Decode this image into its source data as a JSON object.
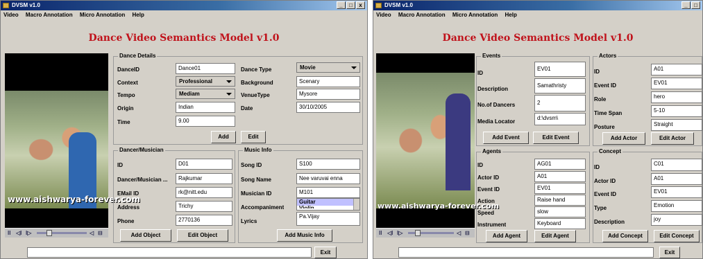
{
  "window_left": {
    "title": "DVSM v1.0",
    "menu": [
      "Video",
      "Macro Annotation",
      "Micro Annotation",
      "Help"
    ],
    "app_title": "Dance Video Semantics Model v1.0",
    "watermark": "www.aishwarya-forever.com",
    "dance_details": {
      "group_title": "Dance Details",
      "dance_id_label": "DanceID",
      "dance_id_value": "Dance01",
      "context_label": "Context",
      "context_value": "Professional",
      "tempo_label": "Tempo",
      "tempo_value": "Mediam",
      "origin_label": "Origin",
      "origin_value": "Indian",
      "time_label": "Time",
      "time_value": "9.00",
      "dance_type_label": "Dance Type",
      "dance_type_value": "Movie",
      "background_label": "Background",
      "background_value": "Scenary",
      "venue_type_label": "VenueType",
      "venue_type_value": "Mysore",
      "date_label": "Date",
      "date_value": "30/10/2005",
      "add_label": "Add",
      "edit_label": "Edit"
    },
    "dancer": {
      "group_title": "Dancer/Musician",
      "id_label": "ID",
      "id_value": "D01",
      "name_label": "Dancer/Musician ...",
      "name_value": "Rajkumar",
      "email_label": "EMail ID",
      "email_value": "rk@nitt.edu",
      "address_label": "Address",
      "address_value": "Trichy",
      "phone_label": "Phone",
      "phone_value": "2770136",
      "add_object_label": "Add Object",
      "edit_object_label": "Edit Object"
    },
    "music": {
      "group_title": "Music Info",
      "song_id_label": "Song ID",
      "song_id_value": "S100",
      "song_name_label": "Song Name",
      "song_name_value": "Nee varuvai enna",
      "musician_id_label": "Musician ID",
      "musician_id_value": "M101",
      "accompaniment_label": "Accompaniment",
      "accompaniment_selected": "Guitar",
      "accompaniment_next": "Violin",
      "lyrics_label": "Lyrics",
      "lyrics_value": "Pa.Vijay",
      "add_music_label": "Add Music Info"
    },
    "exit_label": "Exit"
  },
  "window_right": {
    "title": "DVSM v1.0",
    "menu": [
      "Video",
      "Macro Annotation",
      "Micro Annotation",
      "Help"
    ],
    "app_title": "Dance Video Semantics Model v1.0",
    "watermark": "www.aishwarya-forever.com",
    "events": {
      "group_title": "Events",
      "id_label": "ID",
      "id_value": "EV01",
      "description_label": "Description",
      "description_value": "Samathristy",
      "dancers_label": "No.of Dancers",
      "dancers_value": "2",
      "locator_label": "Media Locator",
      "locator_value": "d:\\dvsm\\",
      "add_label": "Add Event",
      "edit_label": "Edit Event"
    },
    "actors": {
      "group_title": "Actors",
      "id_label": "ID",
      "id_value": "A01",
      "event_id_label": "Event ID",
      "event_id_value": "EV01",
      "role_label": "Role",
      "role_value": "hero",
      "time_span_label": "Time Span",
      "time_span_value": "5-10",
      "posture_label": "Posture",
      "posture_value": "Straight",
      "add_label": "Add Actor",
      "edit_label": "Edit Actor"
    },
    "agents": {
      "group_title": "Agents",
      "id_label": "ID",
      "id_value": "AG01",
      "actor_id_label": "Actor ID",
      "actor_id_value": "A01",
      "event_id_label": "Event ID",
      "event_id_value": "EV01",
      "action_label": "Action",
      "action_value": "Raise hand",
      "speed_label": "Speed",
      "speed_value": "slow",
      "instrument_label": "Instrument",
      "instrument_value": "Keyboard",
      "add_label": "Add Agent",
      "edit_label": "Edit Agent"
    },
    "concept": {
      "group_title": "Concept",
      "id_label": "ID",
      "id_value": "C01",
      "actor_id_label": "Actor ID",
      "actor_id_value": "A01",
      "event_id_label": "Event ID",
      "event_id_value": "EV01",
      "type_label": "Type",
      "type_value": "Emotion",
      "description_label": "Description",
      "description_value": "joy",
      "add_label": "Add Concept",
      "edit_label": "Edit Concept"
    },
    "exit_label": "Exit"
  },
  "colors": {
    "title_red": "#c0121b",
    "window_bg": "#d4d0c8",
    "titlebar": "#0a246a"
  }
}
